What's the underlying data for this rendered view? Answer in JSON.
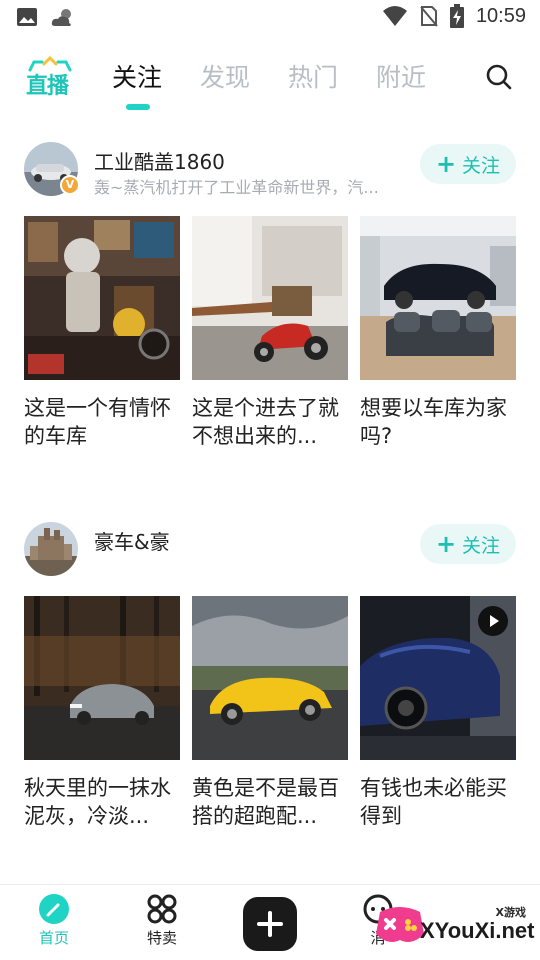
{
  "status_bar": {
    "time": "10:59",
    "left_icons": [
      "image-icon",
      "weather-icon"
    ],
    "right_icons": [
      "wifi-icon",
      "no-sim-icon",
      "battery-charging-icon"
    ]
  },
  "top_nav": {
    "logo_text": "直播",
    "tabs": [
      {
        "label": "关注",
        "active": true
      },
      {
        "label": "发现",
        "active": false
      },
      {
        "label": "热门",
        "active": false
      },
      {
        "label": "附近",
        "active": false
      }
    ],
    "search_icon": "search-icon",
    "accent_color": "#1fd3c5"
  },
  "feed": [
    {
      "username": "工业酷盖1860",
      "verified_badge": "V",
      "description": "轰~蒸汽机打开了工业革命新世界，汽...",
      "follow_label": "关注",
      "posts": [
        {
          "caption": "这是一个有情怀的车库",
          "has_video": false
        },
        {
          "caption": "这是个进去了就不想出来的...",
          "has_video": false
        },
        {
          "caption": "想要以车库为家吗?",
          "has_video": false
        }
      ]
    },
    {
      "username": "豪车&豪",
      "description": "",
      "follow_label": "关注",
      "posts": [
        {
          "caption": "秋天里的一抹水泥灰，冷淡...",
          "has_video": false
        },
        {
          "caption": "黄色是不是最百搭的超跑配...",
          "has_video": false
        },
        {
          "caption": "有钱也未必能买得到",
          "has_video": true
        }
      ]
    }
  ],
  "bottom_nav": {
    "items": [
      {
        "label": "首页",
        "icon": "home-compass-icon",
        "active": true
      },
      {
        "label": "特卖",
        "icon": "sale-grid-icon",
        "active": false
      },
      {
        "label": "",
        "icon": "create-plus-icon",
        "active": false
      },
      {
        "label": "消",
        "icon": "message-icon",
        "active": false
      }
    ]
  },
  "watermark": {
    "main": "XYouXi.net",
    "small": "X游戏"
  }
}
